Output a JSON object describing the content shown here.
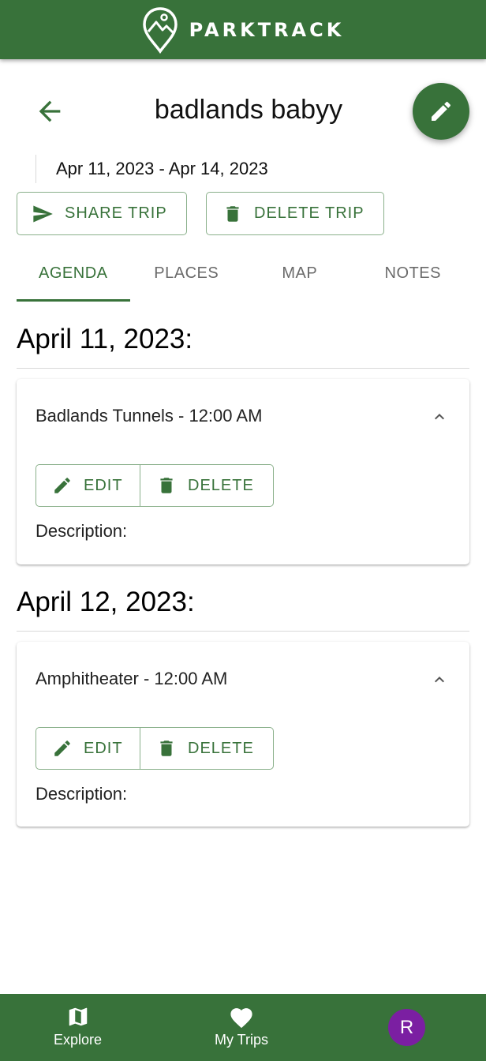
{
  "header": {
    "brand": "PARKTRACK",
    "logo_icon": "map-pin-mountain-icon"
  },
  "trip": {
    "title": "badlands babyy",
    "date_range": "Apr 11, 2023 - Apr 14, 2023",
    "share_label": "SHARE TRIP",
    "delete_label": "DELETE TRIP"
  },
  "tabs": [
    {
      "label": "AGENDA",
      "active": true
    },
    {
      "label": "PLACES",
      "active": false
    },
    {
      "label": "MAP",
      "active": false
    },
    {
      "label": "NOTES",
      "active": false
    }
  ],
  "agenda": [
    {
      "date": "April 11, 2023:",
      "items": [
        {
          "title": "Badlands Tunnels - 12:00 AM",
          "edit_label": "EDIT",
          "delete_label": "DELETE",
          "description_label": "Description:"
        }
      ]
    },
    {
      "date": "April 12, 2023:",
      "items": [
        {
          "title": "Amphitheater - 12:00 AM",
          "edit_label": "EDIT",
          "delete_label": "DELETE",
          "description_label": "Description:"
        }
      ]
    }
  ],
  "bottom_nav": {
    "explore_label": "Explore",
    "trips_label": "My Trips",
    "avatar_initial": "R"
  },
  "colors": {
    "primary": "#38723a",
    "avatar": "#7b1fa2",
    "border": "#8ab08b"
  }
}
